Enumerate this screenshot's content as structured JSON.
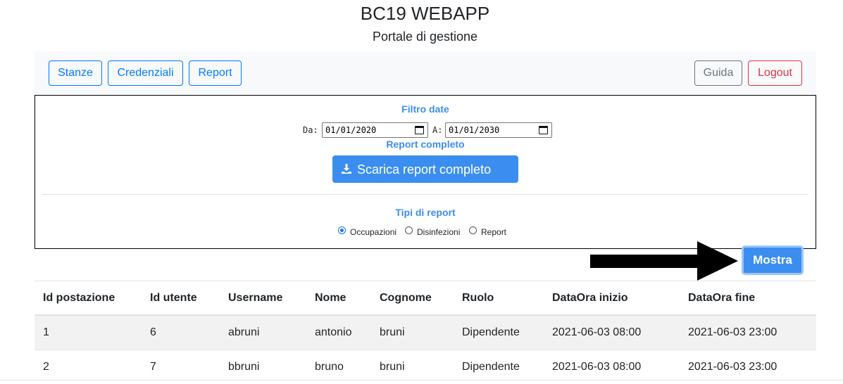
{
  "header": {
    "title": "BC19 WEBAPP",
    "subtitle": "Portale di gestione"
  },
  "nav": {
    "left": [
      "Stanze",
      "Credenziali",
      "Report"
    ],
    "guida": "Guida",
    "logout": "Logout"
  },
  "filter": {
    "title": "Filtro date",
    "from_label": "Da:",
    "from_value": "01/01/2020",
    "to_label": "A:",
    "to_value": "01/01/2030"
  },
  "full_report": {
    "title": "Report completo",
    "button": "Scarica report completo",
    "icon": "download-icon"
  },
  "report_types": {
    "title": "Tipi di report",
    "options": [
      "Occupazioni",
      "Disinfezioni",
      "Report"
    ],
    "selected": "Occupazioni"
  },
  "show_button": "Mostra",
  "table": {
    "headers": [
      "Id postazione",
      "Id utente",
      "Username",
      "Nome",
      "Cognome",
      "Ruolo",
      "DataOra inizio",
      "DataOra fine"
    ],
    "rows": [
      [
        "1",
        "6",
        "abruni",
        "antonio",
        "bruni",
        "Dipendente",
        "2021-06-03 08:00",
        "2021-06-03 23:00"
      ],
      [
        "2",
        "7",
        "bbruni",
        "bruno",
        "bruni",
        "Dipendente",
        "2021-06-03 08:00",
        "2021-06-03 23:00"
      ]
    ]
  },
  "colors": {
    "primary": "#007bff",
    "accent": "#3b8ef0",
    "danger": "#dc3545",
    "secondary": "#6c757d"
  }
}
